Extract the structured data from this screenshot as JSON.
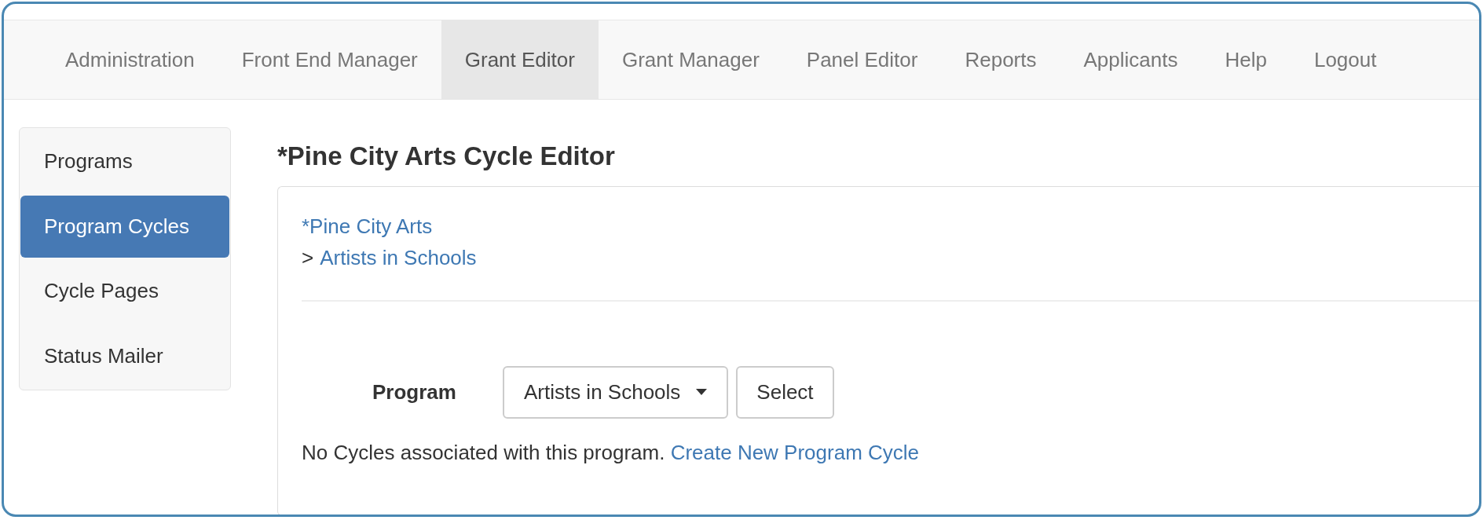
{
  "nav": [
    {
      "label": "Administration",
      "selected": false
    },
    {
      "label": "Front End Manager",
      "selected": false
    },
    {
      "label": "Grant Editor",
      "selected": true
    },
    {
      "label": "Grant Manager",
      "selected": false
    },
    {
      "label": "Panel Editor",
      "selected": false
    },
    {
      "label": "Reports",
      "selected": false
    },
    {
      "label": "Applicants",
      "selected": false
    },
    {
      "label": "Help",
      "selected": false
    },
    {
      "label": "Logout",
      "selected": false
    }
  ],
  "sidebar": [
    {
      "label": "Programs",
      "selected": false
    },
    {
      "label": "Program Cycles",
      "selected": true
    },
    {
      "label": "Cycle Pages",
      "selected": false
    },
    {
      "label": "Status Mailer",
      "selected": false
    }
  ],
  "title": "*Pine City Arts Cycle Editor",
  "breadcrumb": [
    {
      "label": "*Pine City Arts"
    },
    {
      "separator": ">",
      "label": "Artists in Schools"
    }
  ],
  "form": {
    "label": "Program",
    "dropdown": {
      "value": "Artists in Schools"
    },
    "button": "Select"
  },
  "message": {
    "text": "No Cycles associated with this program.",
    "link": "Create New Program Cycle"
  }
}
